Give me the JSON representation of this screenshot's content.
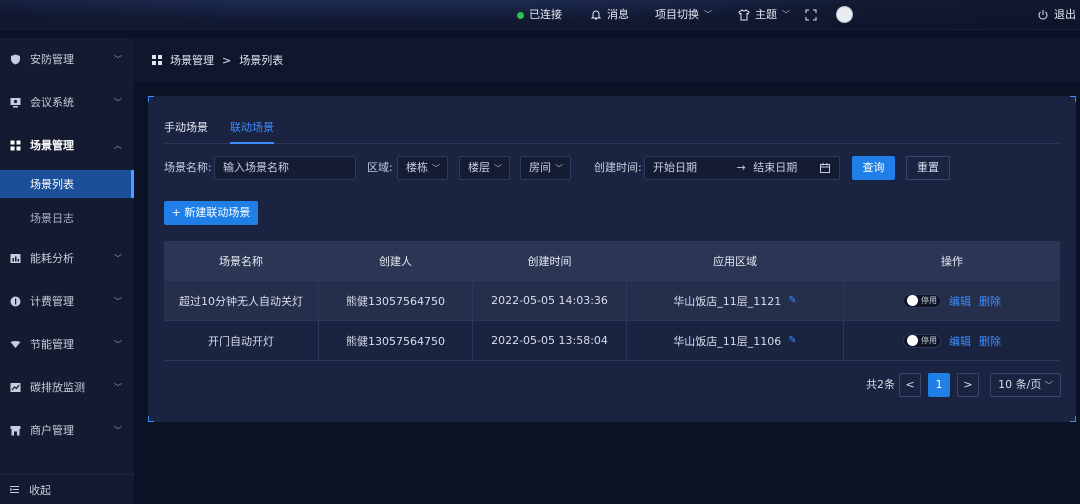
{
  "topbar": {
    "connection": "已连接",
    "messages": "消息",
    "project_switch": "项目切换",
    "theme": "主题",
    "logout": "退出"
  },
  "sidebar": {
    "items": [
      {
        "label": "安防管理",
        "icon": "shield-icon"
      },
      {
        "label": "会议系统",
        "icon": "monitor-icon"
      },
      {
        "label": "场景管理",
        "icon": "grid-icon"
      },
      {
        "label": "能耗分析",
        "icon": "bar-chart-icon"
      },
      {
        "label": "计费管理",
        "icon": "coin-icon"
      },
      {
        "label": "节能管理",
        "icon": "leaf-icon"
      },
      {
        "label": "碳排放监测",
        "icon": "trend-icon"
      },
      {
        "label": "商户管理",
        "icon": "store-icon"
      }
    ],
    "sub_items": [
      "场景列表",
      "场景日志"
    ],
    "collapse": "收起"
  },
  "breadcrumb": {
    "parent": "场景管理",
    "separator": ">",
    "current": "场景列表"
  },
  "tabs": [
    "手动场景",
    "联动场景"
  ],
  "filters": {
    "name_label": "场景名称:",
    "name_placeholder": "输入场景名称",
    "area_label": "区域:",
    "building": "楼栋",
    "floor": "楼层",
    "room": "房间",
    "time_label": "创建时间:",
    "start_placeholder": "开始日期",
    "arrow": "→",
    "end_placeholder": "结束日期",
    "search": "查询",
    "reset": "重置"
  },
  "new_button": "+ 新建联动场景",
  "table": {
    "headers": [
      "场景名称",
      "创建人",
      "创建时间",
      "应用区域",
      "操作"
    ],
    "rows": [
      {
        "name": "超过10分钟无人自动关灯",
        "creator": "熊健13057564750",
        "time": "2022-05-05 14:03:36",
        "area": "华山饭店_11层_1121",
        "status": "停用",
        "edit": "编辑",
        "delete": "删除"
      },
      {
        "name": "开门自动开灯",
        "creator": "熊健13057564750",
        "time": "2022-05-05 13:58:04",
        "area": "华山饭店_11层_1106",
        "status": "停用",
        "edit": "编辑",
        "delete": "删除"
      }
    ]
  },
  "pagination": {
    "total": "共2条",
    "page": "1",
    "page_size": "10 条/页"
  },
  "colors": {
    "accent": "#1f7fe6",
    "link": "#3d8bff",
    "connected": "#2ac24a"
  }
}
